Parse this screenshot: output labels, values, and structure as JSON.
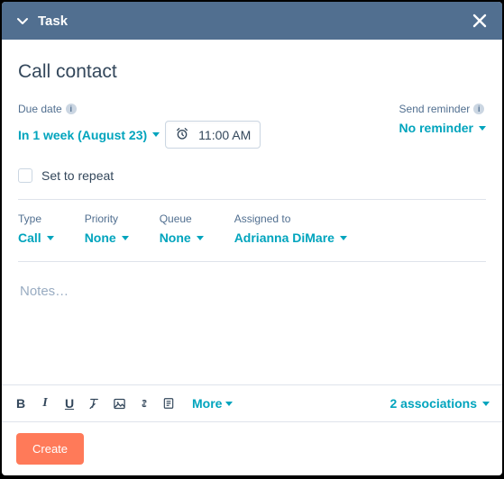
{
  "header": {
    "title": "Task"
  },
  "task": {
    "title": "Call contact"
  },
  "due_date": {
    "label": "Due date",
    "value": "In 1 week (August 23)",
    "time": "11:00 AM"
  },
  "reminder": {
    "label": "Send reminder",
    "value": "No reminder"
  },
  "repeat": {
    "label": "Set to repeat"
  },
  "type": {
    "label": "Type",
    "value": "Call"
  },
  "priority": {
    "label": "Priority",
    "value": "None"
  },
  "queue": {
    "label": "Queue",
    "value": "None"
  },
  "assigned": {
    "label": "Assigned to",
    "value": "Adrianna DiMare"
  },
  "notes": {
    "placeholder": "Notes…"
  },
  "toolbar": {
    "more": "More"
  },
  "associations": {
    "label": "2 associations"
  },
  "footer": {
    "create": "Create"
  }
}
